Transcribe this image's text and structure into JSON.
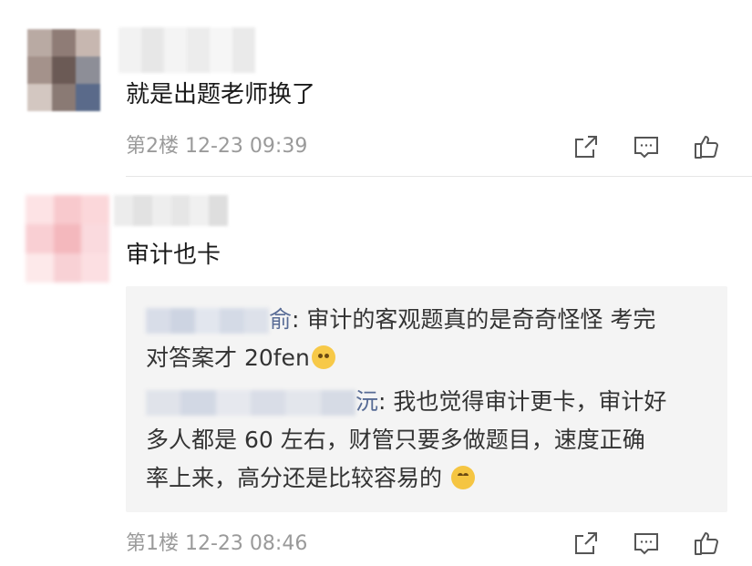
{
  "comments": [
    {
      "content": "就是出题老师换了",
      "floor": "第2楼",
      "time": "12-23 09:39",
      "avatar_colors": [
        "#b9aaa3",
        "#8f7c76",
        "#c7b7b0",
        "#a4928b",
        "#6b5a55",
        "#8d8e97",
        "#d3c7c1",
        "#8a7a74",
        "#5a6a8a"
      ],
      "name_colors": [
        "#f2f2f2",
        "#e7e7e7",
        "#f4f4f4",
        "#ececec",
        "#f6f6f6",
        "#eaeaea"
      ]
    },
    {
      "content": "审计也卡",
      "floor": "第1楼",
      "time": "12-23 08:46",
      "avatar_colors": [
        "#fde3e5",
        "#f8c9cd",
        "#fbd7da",
        "#f9cfd3",
        "#f4b8bd",
        "#fadade",
        "#fde9ea",
        "#f8d1d5",
        "#fcdfe2"
      ],
      "name_colors": [
        "#ececec",
        "#e2e2e2",
        "#eeeeee",
        "#e6e6e6",
        "#f0f0f0",
        "#dedede"
      ],
      "replies": [
        {
          "name_tail": "俞",
          "text_line1": ": 审计的客观题真的是奇奇怪怪  考完",
          "text_line2": "对答案才 20fen",
          "emoji": "ohno-emoji"
        },
        {
          "name_tail": "沅",
          "text_line1": ": 我也觉得审计更卡，审计好",
          "text_line2": "多人都是 60 左右，财管只要多做题目，速度正确",
          "text_line3": "率上来，高分还是比较容易的",
          "emoji": "laugh-emoji"
        }
      ]
    }
  ],
  "icons": {
    "share": "share-icon",
    "comment": "comment-icon",
    "like": "like-icon"
  },
  "colors": {
    "link_name": "#576b95",
    "meta_text": "#9a9a9a",
    "reply_bg": "#f4f4f4"
  }
}
